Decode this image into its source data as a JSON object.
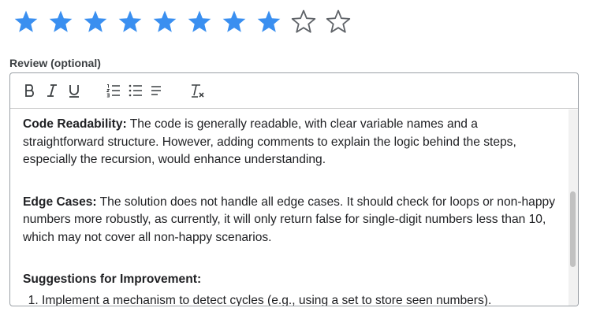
{
  "rating": {
    "value": 8,
    "max": 10,
    "filled_color": "#3a8ff0",
    "empty_color": "#5f6368"
  },
  "review": {
    "label": "Review (optional)",
    "toolbar": {
      "bold_icon": "bold-icon",
      "italic_icon": "italic-icon",
      "underline_icon": "underline-icon",
      "ordered_list_icon": "ordered-list-icon",
      "bullet_list_icon": "bullet-list-icon",
      "align_icon": "align-left-icon",
      "clear_format_icon": "clear-formatting-icon"
    },
    "paragraphs": [
      {
        "heading": "Code Readability:",
        "text": " The code is generally readable, with clear variable names and a straightforward structure. However, adding comments to explain the logic behind the steps, especially the recursion, would enhance understanding."
      },
      {
        "heading": "Edge Cases:",
        "text": " The solution does not handle all edge cases. It should check for loops or non-happy numbers more robustly, as currently, it will only return false for single-digit numbers less than 10, which may not cover all non-happy scenarios."
      }
    ],
    "suggestions_heading": "Suggestions for Improvement:",
    "suggestions": [
      "Implement a mechanism to detect cycles (e.g., using a set to store seen numbers)."
    ]
  }
}
